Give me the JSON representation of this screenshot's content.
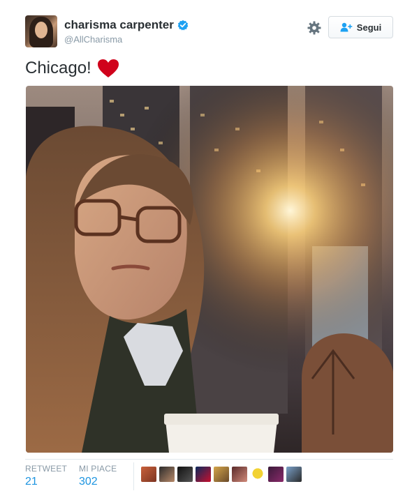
{
  "author": {
    "display_name": "charisma carpenter",
    "handle": "@AllCharisma"
  },
  "follow_button": {
    "label": "Segui"
  },
  "tweet": {
    "text": "Chicago!"
  },
  "stats": {
    "retweets_label": "RETWEET",
    "retweets_count": "21",
    "likes_label": "MI PIACE",
    "likes_count": "302"
  },
  "colors": {
    "link_blue": "#1c94e0",
    "heart_red": "#d0021b",
    "verified_blue": "#1da1f2"
  }
}
